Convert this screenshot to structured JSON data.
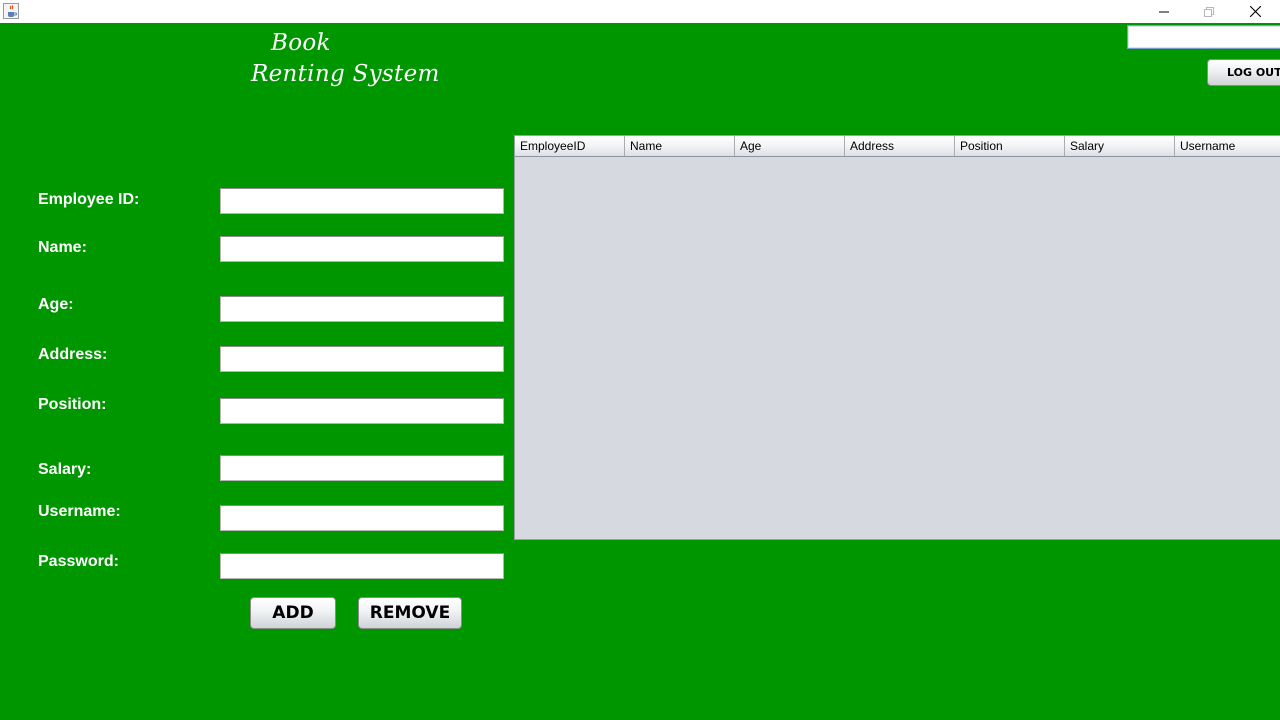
{
  "window": {
    "icon": "java-cup-icon",
    "controls": [
      "minimize-icon",
      "restore-icon",
      "close-icon"
    ]
  },
  "header": {
    "title_line1": "Book",
    "title_line2": "Renting System"
  },
  "top_bar": {
    "search_value": "",
    "logout_label": "LOG OUT"
  },
  "form": {
    "employee_id_label": "Employee ID:",
    "name_label": "Name:",
    "age_label": "Age:",
    "address_label": "Address:",
    "position_label": "Position:",
    "salary_label": "Salary:",
    "username_label": "Username:",
    "password_label": "Password:",
    "employee_id_value": "",
    "name_value": "",
    "age_value": "",
    "address_value": "",
    "position_value": "",
    "salary_value": "",
    "username_value": "",
    "password_value": ""
  },
  "actions": {
    "add_label": "ADD",
    "remove_label": "REMOVE"
  },
  "table": {
    "columns": [
      "EmployeeID",
      "Name",
      "Age",
      "Address",
      "Position",
      "Salary",
      "Username"
    ],
    "rows": []
  },
  "colors": {
    "background": "#009600",
    "table_background": "#d6d9e0"
  }
}
